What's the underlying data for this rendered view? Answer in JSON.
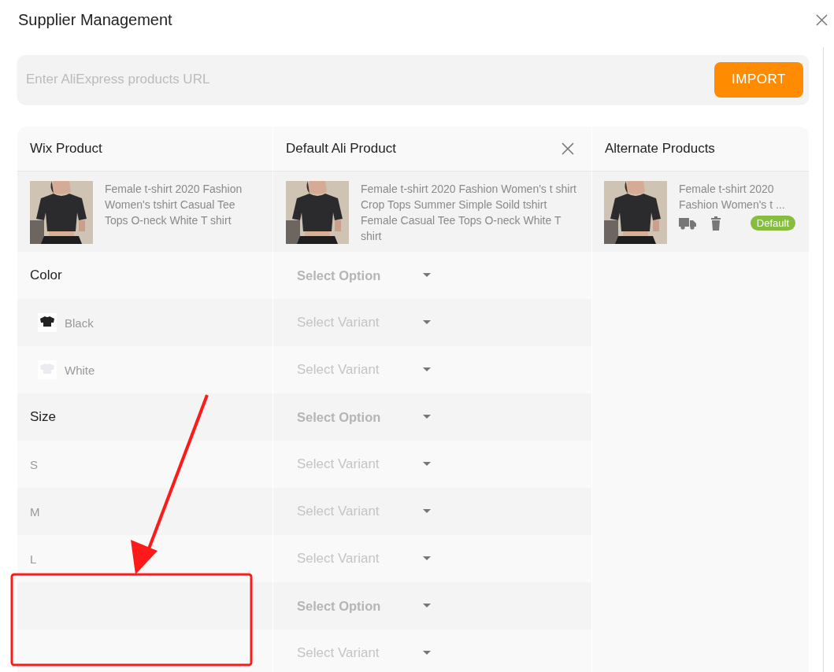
{
  "dialog": {
    "title": "Supplier Management"
  },
  "import_bar": {
    "placeholder": "Enter AliExpress products URL",
    "button": "IMPORT"
  },
  "columns": [
    "Wix Product",
    "Default Ali Product",
    "Alternate Products"
  ],
  "wix_product": {
    "kind": "picture",
    "title": "Female t-shirt 2020 Fashion Women's tshirt Casual Tee Tops O-neck White T shirt"
  },
  "default_product": {
    "kind": "picture",
    "title": "Female t-shirt 2020 Fashion Women's t shirt Crop Tops Summer Simple Soild tshirt Female Casual Tee Tops O-neck White T shirt"
  },
  "alternates": [
    {
      "kind": "picture",
      "title": "Female t-shirt 2020 Fashion Women's t ...",
      "badge": "Default"
    }
  ],
  "rows": [
    {
      "kind": "option",
      "label": "Color",
      "select": "Select Option"
    },
    {
      "kind": "variant",
      "label": "Black",
      "color": "#222222",
      "select": "Select Variant"
    },
    {
      "kind": "variant",
      "label": "White",
      "color": "#ecebf2",
      "select": "Select Variant"
    },
    {
      "kind": "option",
      "label": "Size",
      "select": "Select Option"
    },
    {
      "kind": "variant",
      "label": "S",
      "select": "Select Variant"
    },
    {
      "kind": "variant",
      "label": "M",
      "select": "Select Variant"
    },
    {
      "kind": "variant",
      "label": "L",
      "select": "Select Variant"
    },
    {
      "kind": "option",
      "select": "Select Option"
    },
    {
      "kind": "variant",
      "select": "Select Variant"
    }
  ]
}
